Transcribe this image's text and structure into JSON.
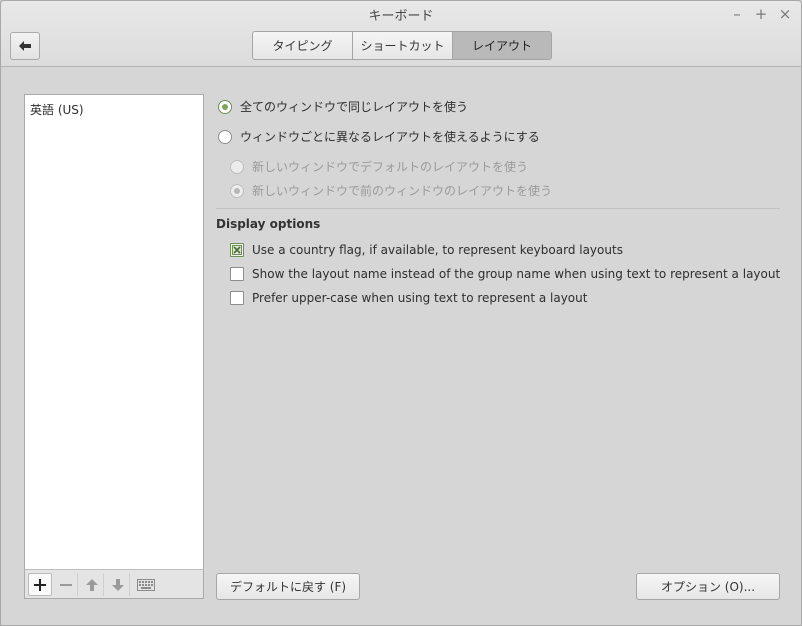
{
  "window": {
    "title": "キーボード",
    "controls": {
      "minimize": "–",
      "maximize": "+",
      "close": "×"
    }
  },
  "tabs": [
    {
      "label": "タイピング",
      "active": false
    },
    {
      "label": "ショートカット",
      "active": false
    },
    {
      "label": "レイアウト",
      "active": true
    }
  ],
  "layouts": {
    "items": [
      "英語 (US)"
    ],
    "toolbar_icons": [
      "add-icon",
      "remove-icon",
      "move-up-icon",
      "move-down-icon",
      "keyboard-icon"
    ]
  },
  "layout_mode": {
    "options": [
      {
        "label": "全てのウィンドウで同じレイアウトを使う",
        "selected": true,
        "enabled": true
      },
      {
        "label": "ウィンドウごとに異なるレイアウトを使えるようにする",
        "selected": false,
        "enabled": true
      }
    ],
    "sub_options": [
      {
        "label": "新しいウィンドウでデフォルトのレイアウトを使う",
        "selected": false,
        "enabled": false
      },
      {
        "label": "新しいウィンドウで前のウィンドウのレイアウトを使う",
        "selected": true,
        "enabled": false
      }
    ]
  },
  "display_options": {
    "title": "Display options",
    "items": [
      {
        "label": "Use a country flag, if available,  to represent keyboard layouts",
        "checked": true
      },
      {
        "label": "Show the layout name instead of the group name when using text to represent a layout",
        "checked": false
      },
      {
        "label": "Prefer upper-case when using text to represent a layout",
        "checked": false
      }
    ]
  },
  "buttons": {
    "reset": "デフォルトに戻す (F)",
    "options": "オプション (O)..."
  },
  "colors": {
    "accent": "#7fa35f",
    "background": "#d6d6d6"
  }
}
